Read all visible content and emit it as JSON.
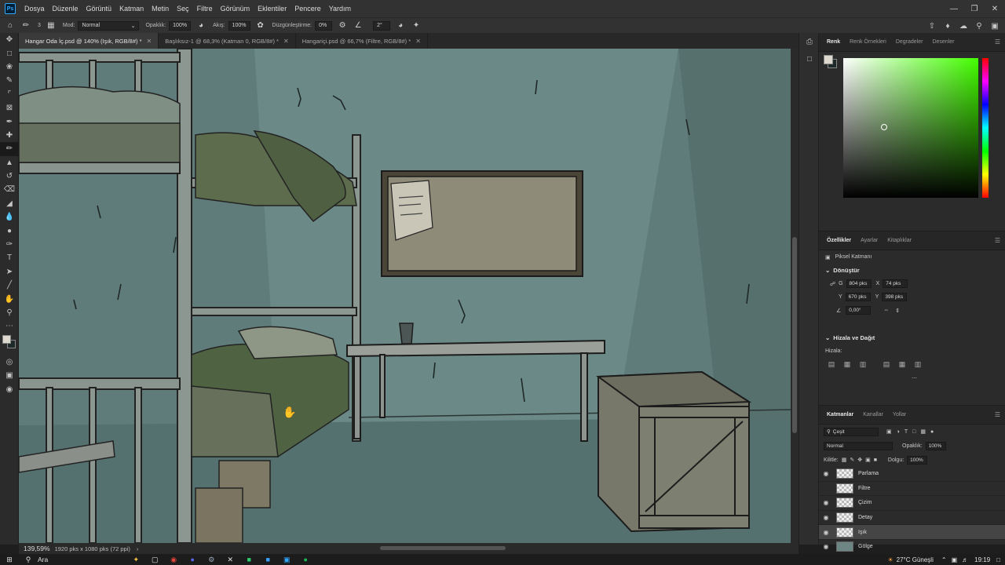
{
  "menubar": {
    "app_badge": "Ps",
    "items": [
      "Dosya",
      "Düzenle",
      "Görüntü",
      "Katman",
      "Metin",
      "Seç",
      "Filtre",
      "Görünüm",
      "Eklentiler",
      "Pencere",
      "Yardım"
    ]
  },
  "options": {
    "brush_size": "3",
    "mode_label": "Mod:",
    "mode_value": "Normal",
    "opacity_label": "Opaklık:",
    "opacity_value": "100%",
    "flow_label": "Akış:",
    "flow_value": "100%",
    "smoothing_label": "Düzgünleştirme:",
    "smoothing_value": "0%",
    "angle_value": "2°"
  },
  "tabs": [
    {
      "label": "Hangar Oda İç.psd @ 140% (Işık, RGB/8#) *",
      "active": true
    },
    {
      "label": "Başlıksız-1 @ 68,3% (Katman 0, RGB/8#) *",
      "active": false
    },
    {
      "label": "Hangariçi.psd @ 66,7% (Filtre, RGB/8#) *",
      "active": false
    }
  ],
  "status": {
    "zoom": "139,59%",
    "doc_info": "1920 pks x 1080 pks (72 ppi)"
  },
  "color_panel": {
    "tabs": [
      "Renk",
      "Renk Örnekleri",
      "Degradeler",
      "Desenler"
    ],
    "hue_color": "#43ff00"
  },
  "properties": {
    "tabs": [
      "Özellikler",
      "Ayarlar",
      "Kitaplıklar"
    ],
    "layer_type": "Piksel Katmanı",
    "transform_heading": "Dönüştür",
    "w_label": "G",
    "w_value": "804 pks",
    "x_label": "X",
    "x_value": "74 pks",
    "h_label": "Y",
    "h_value": "670 pks",
    "y_label": "Y",
    "y_value": "398 pks",
    "angle_value": "0,00°",
    "align_heading": "Hizala ve Dağıt",
    "align_label": "Hizala:"
  },
  "layers_panel": {
    "tabs": [
      "Katmanlar",
      "Kanallar",
      "Yollar"
    ],
    "filter_label": "Çeşit",
    "blend_mode": "Normal",
    "opacity_label": "Opaklık:",
    "opacity_value": "100%",
    "lock_label": "Kilitle:",
    "fill_label": "Dolgu:",
    "fill_value": "100%",
    "layers": [
      {
        "name": "Parlama",
        "visible": true,
        "selected": false
      },
      {
        "name": "Filtre",
        "visible": false,
        "selected": false
      },
      {
        "name": "Çizim",
        "visible": true,
        "selected": false
      },
      {
        "name": "Detay",
        "visible": true,
        "selected": false
      },
      {
        "name": "Işık",
        "visible": true,
        "selected": true
      },
      {
        "name": "Gölge",
        "visible": true,
        "selected": false
      }
    ]
  },
  "taskbar": {
    "search_label": "Ara",
    "weather": "27°C Güneşli",
    "time": "19:19"
  }
}
